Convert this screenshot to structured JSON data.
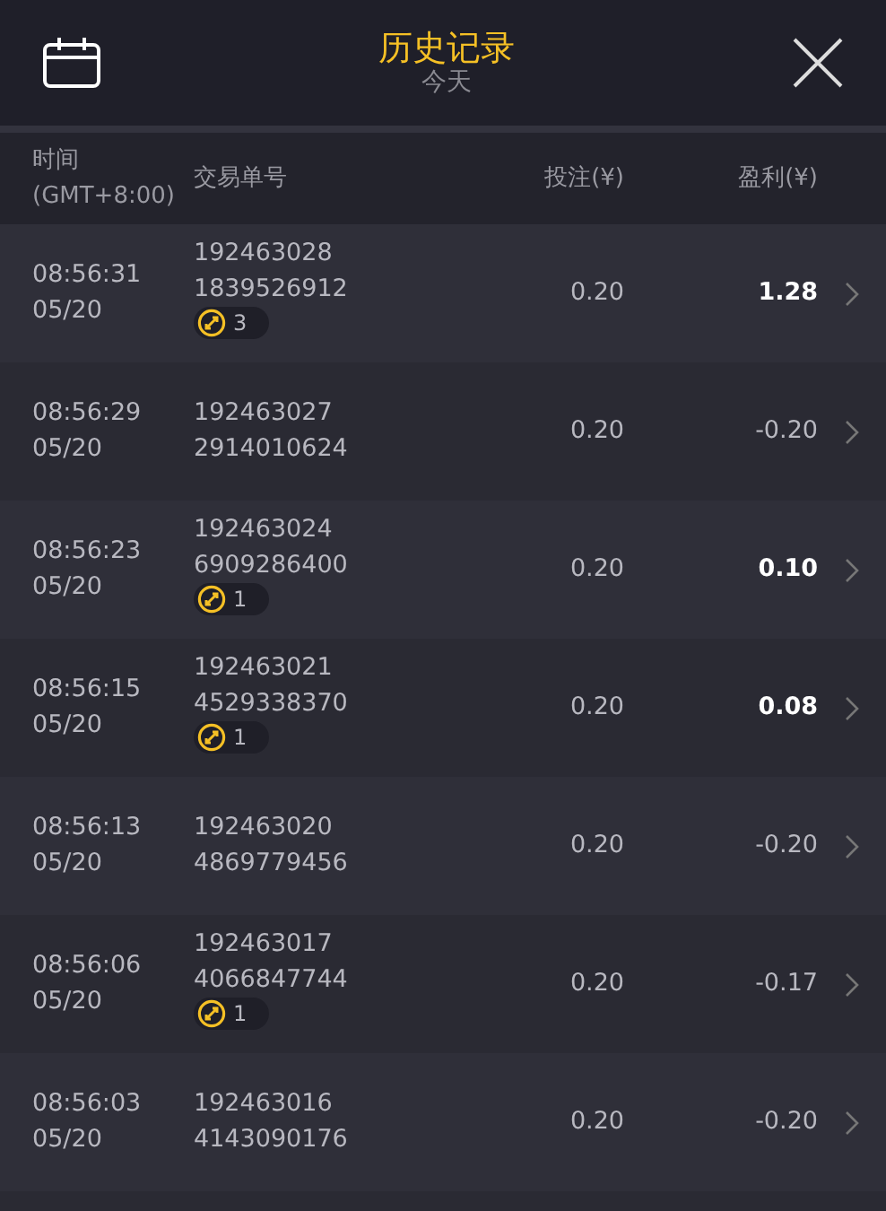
{
  "header": {
    "title": "历史记录",
    "subtitle": "今天"
  },
  "columns": [
    {
      "label": "时间",
      "sublabel": "(GMT+8:00)"
    },
    {
      "label": "交易单号"
    },
    {
      "label": "投注(¥)"
    },
    {
      "label": "盈利(¥)"
    }
  ],
  "rows": [
    {
      "time": "08:56:31",
      "date": "05/20",
      "order_id": "192463028",
      "order_no": "1839526912",
      "badge": "3",
      "bet": "0.20",
      "profit": "1.28",
      "highlight": true
    },
    {
      "time": "08:56:29",
      "date": "05/20",
      "order_id": "192463027",
      "order_no": "2914010624",
      "bet": "0.20",
      "profit": "-0.20",
      "highlight": false
    },
    {
      "time": "08:56:23",
      "date": "05/20",
      "order_id": "192463024",
      "order_no": "6909286400",
      "badge": "1",
      "bet": "0.20",
      "profit": "0.10",
      "highlight": true
    },
    {
      "time": "08:56:15",
      "date": "05/20",
      "order_id": "192463021",
      "order_no": "4529338370",
      "badge": "1",
      "bet": "0.20",
      "profit": "0.08",
      "highlight": true
    },
    {
      "time": "08:56:13",
      "date": "05/20",
      "order_id": "192463020",
      "order_no": "4869779456",
      "bet": "0.20",
      "profit": "-0.20",
      "highlight": false
    },
    {
      "time": "08:56:06",
      "date": "05/20",
      "order_id": "192463017",
      "order_no": "4066847744",
      "badge": "1",
      "bet": "0.20",
      "profit": "-0.17",
      "highlight": false
    },
    {
      "time": "08:56:03",
      "date": "05/20",
      "order_id": "192463016",
      "order_no": "4143090176",
      "bet": "0.20",
      "profit": "-0.20",
      "highlight": false
    }
  ]
}
